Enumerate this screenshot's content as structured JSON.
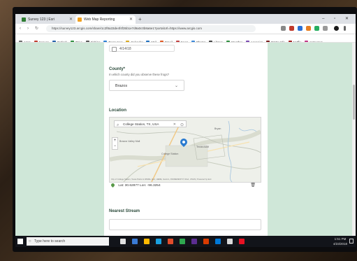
{
  "browser": {
    "tabs": [
      {
        "label": "Survey 123 | Esri",
        "favicon_color": "#2e7d32"
      },
      {
        "label": "Web Map Reporting",
        "favicon_color": "#f0a020"
      }
    ],
    "new_tab": "+",
    "window_controls": "– ▫ ✕",
    "nav": {
      "back": "‹",
      "forward": "›",
      "reload": "↻"
    },
    "url": "https://survey123.arcgis.com/share/1c2f8a33de4f4f35b1e7d9a0c0b8a6e1?portalUrl=https://www.arcgis.com"
  },
  "bookmarks": [
    {
      "label": "Apps",
      "color": "#6a6a6a"
    },
    {
      "label": "Canvas",
      "color": "#c0392b"
    },
    {
      "label": "Outlook",
      "color": "#1f5fa8"
    },
    {
      "label": "Drive",
      "color": "#2f8f3f"
    },
    {
      "label": "Fishing",
      "color": "#555555"
    },
    {
      "label": "Resources",
      "color": "#2a7fd4"
    },
    {
      "label": "Calendar",
      "color": "#d9a81f"
    },
    {
      "label": "Mail",
      "color": "#1f6fbf"
    },
    {
      "label": "Email",
      "color": "#e05a25"
    },
    {
      "label": "News",
      "color": "#c24040"
    },
    {
      "label": "Photos",
      "color": "#3b87d9"
    },
    {
      "label": "Library",
      "color": "#444444"
    },
    {
      "label": "Weather",
      "color": "#2f8f3f"
    },
    {
      "label": "Agencies",
      "color": "#7a4ab0"
    },
    {
      "label": "TAMU Info",
      "color": "#7a1f1f"
    },
    {
      "label": "Netflix",
      "color": "#a02020"
    },
    {
      "label": "Instagram",
      "color": "#c13584"
    }
  ],
  "form": {
    "date_value": "4/14/18",
    "county_label": "County*",
    "county_helper": "In which county did you observe these frogs?",
    "county_value": "Brazos",
    "location_label": "Location",
    "map_search_value": "College Station, TX, USA",
    "map_clear": "✕",
    "map_labels": [
      "Brazos Valley Mall",
      "Texas A&M",
      "College Station",
      "Bryan"
    ],
    "map_attribution": "City of College Station, Texas Parks & Wildlife, Esri, HERE, Garmin, INCREMENT P, NGA, USGS | Powered by Esri",
    "coordinates": "Lat: 30.62877  Lon: -96.3254",
    "nearest_stream_label": "Nearest Stream"
  },
  "taskbar": {
    "search_placeholder": "Type here to search",
    "clock_time": "1:51 PM",
    "clock_date": "4/23/2018",
    "pinned_colors": [
      "#e0e0e0",
      "#3a7bd5",
      "#ffb900",
      "#1aa0e0",
      "#e14c2b",
      "#2fa84f",
      "#5c2d91",
      "#d83b01",
      "#0078d7",
      "#d9d9d9",
      "#e81123"
    ]
  },
  "colors": {
    "page_background": "#cfe7d8",
    "card_background": "#ffffff",
    "accent_pin": "#2b7bd0"
  }
}
